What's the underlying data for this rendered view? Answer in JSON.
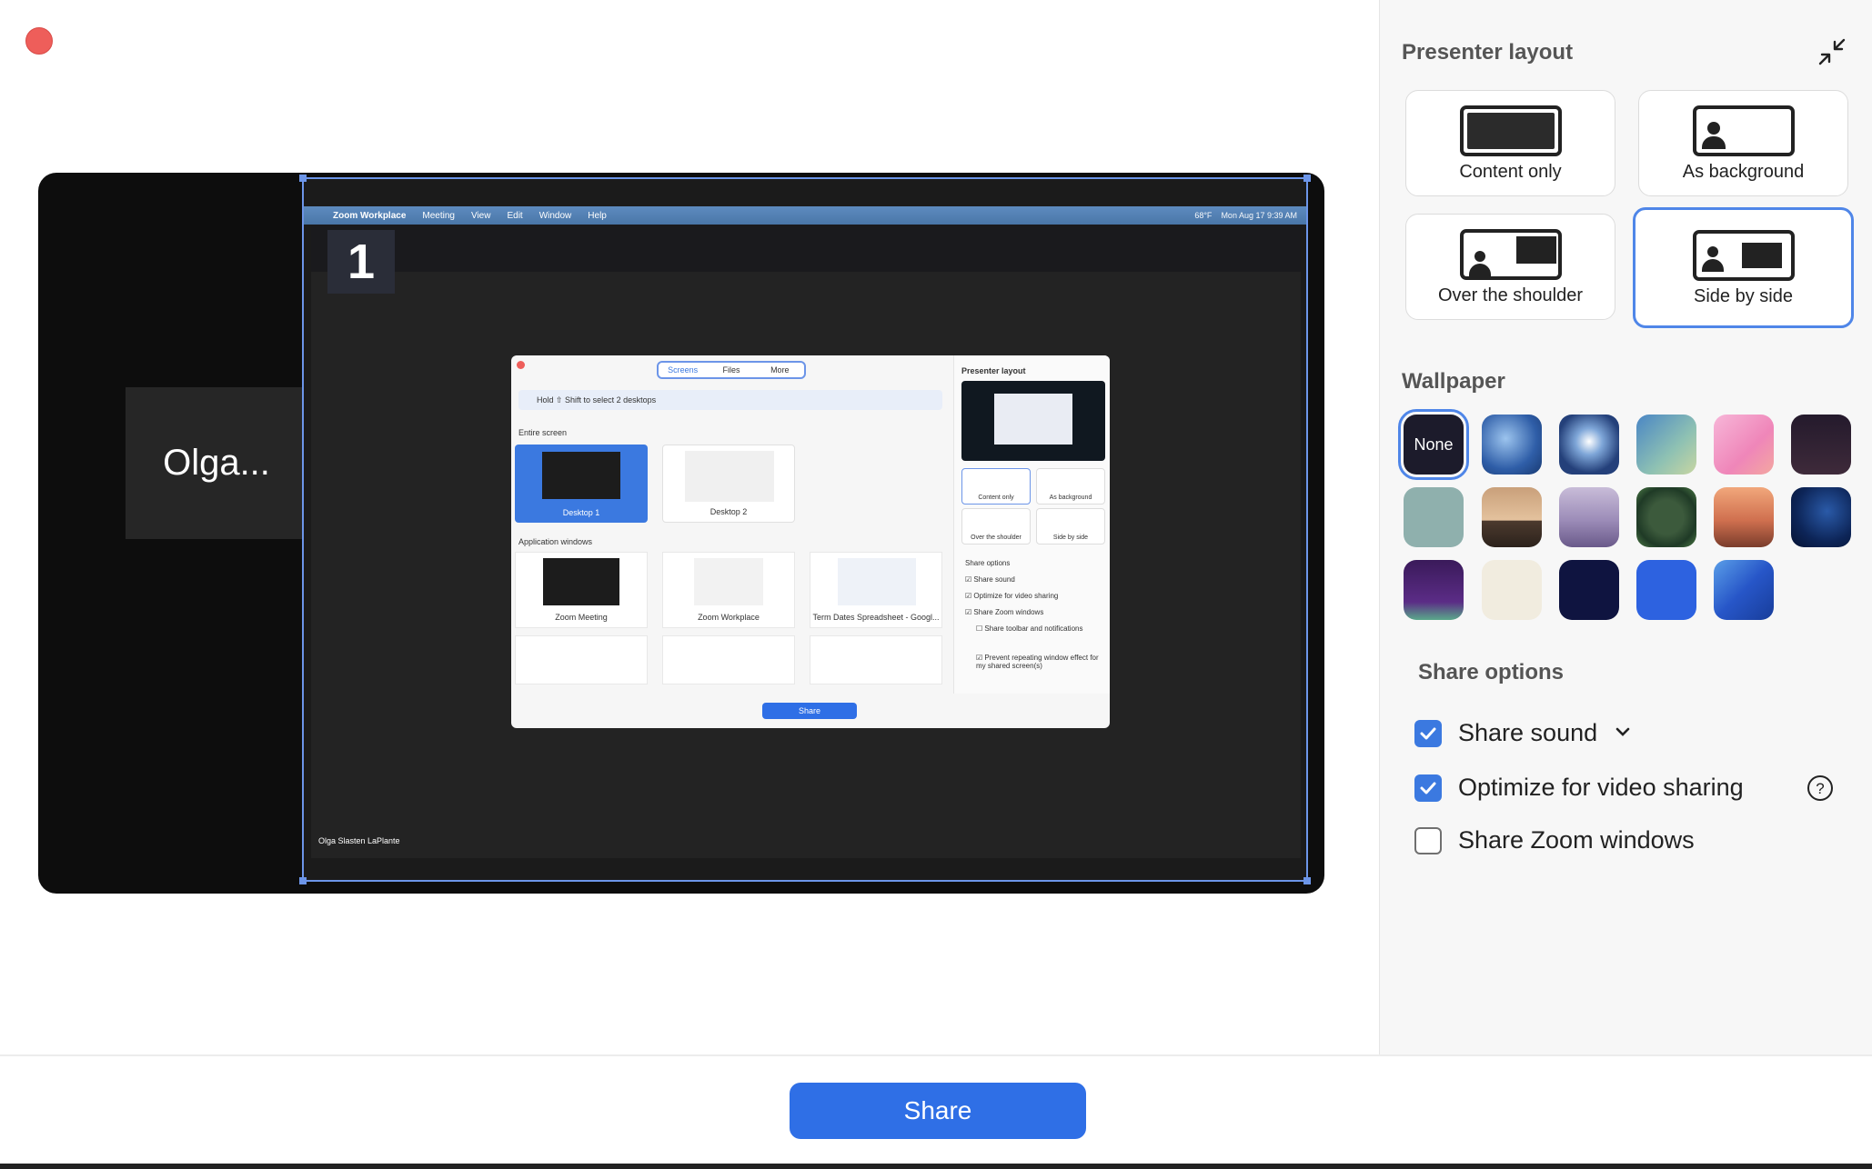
{
  "preview": {
    "participant_short": "Olga...",
    "screen_number": "1",
    "menubar": {
      "app": "Zoom Workplace",
      "items": [
        "Meeting",
        "View",
        "Edit",
        "Window",
        "Help"
      ],
      "weather": "68°F",
      "clock": "Mon Aug 17  9:39 AM"
    },
    "participant_full": "Olga Slasten LaPlante",
    "mini_dialog": {
      "tabs": [
        "Screens",
        "Files",
        "More"
      ],
      "hint": "Hold ⇧ Shift to select 2 desktops",
      "entire_screen": "Entire screen",
      "desktops": [
        "Desktop 1",
        "Desktop 2"
      ],
      "app_windows": "Application windows",
      "apps": [
        "Zoom Meeting",
        "Zoom Workplace",
        "Term Dates Spreadsheet - Googl..."
      ],
      "presenter_layout": "Presenter layout",
      "layouts": [
        "Content only",
        "As background",
        "Over the shoulder",
        "Side by side"
      ],
      "share_options": "Share options",
      "options": [
        "Share sound",
        "Optimize for video sharing",
        "Share Zoom windows",
        "Share toolbar and notifications",
        "Prevent repeating window effect for my shared screen(s)"
      ],
      "share": "Share"
    }
  },
  "panel": {
    "presenter_layout_title": "Presenter layout",
    "layouts": [
      {
        "label": "Content only"
      },
      {
        "label": "As background"
      },
      {
        "label": "Over the shoulder"
      },
      {
        "label": "Side by side",
        "selected": true
      }
    ],
    "wallpaper_title": "Wallpaper",
    "wallpaper_none": "None",
    "wallpapers": [
      "blue-swirl",
      "light-burst",
      "teal-gradient",
      "pink-gradient",
      "dark-purple",
      "sage",
      "desert-sunset",
      "purple-mountains",
      "jungle-frame",
      "canyon",
      "deep-sea",
      "purple-night",
      "cream",
      "navy",
      "blue-grid",
      "blue-waves"
    ],
    "share_options_title": "Share options",
    "options": [
      {
        "label": "Share sound",
        "checked": true
      },
      {
        "label": "Optimize for video sharing",
        "checked": true
      },
      {
        "label": "Share Zoom windows",
        "checked": false
      }
    ]
  },
  "footer": {
    "share_label": "Share"
  },
  "colors": {
    "accent": "#2f6fe6",
    "selection": "#4f86e8",
    "close": "#ee5e5a"
  }
}
